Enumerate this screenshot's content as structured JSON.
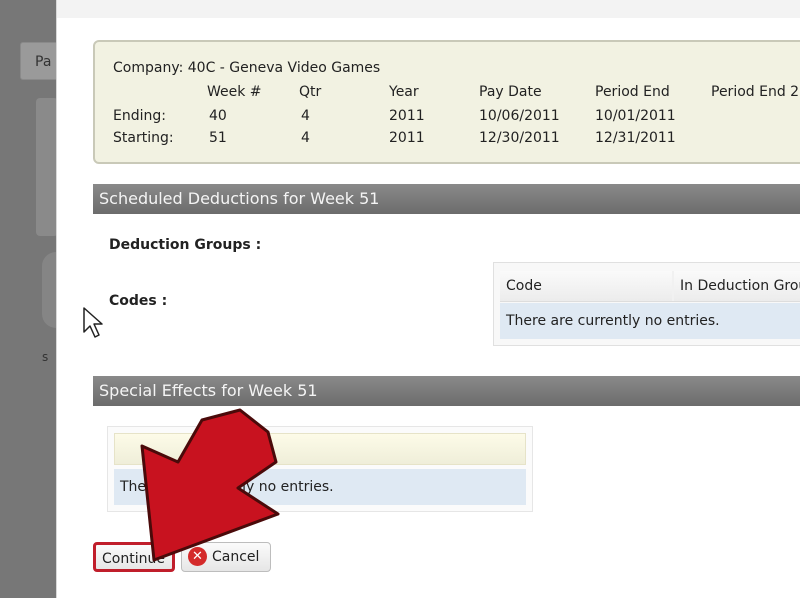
{
  "background": {
    "tab_label": "Pa",
    "side_letter": "s"
  },
  "info": {
    "company": "Company: 40C - Geneva Video Games",
    "headers": [
      "Week #",
      "Qtr",
      "Year",
      "Pay Date",
      "Period End",
      "Period End 2"
    ],
    "ending": {
      "label": "Ending:",
      "values": [
        "40",
        "4",
        "2011",
        "10/06/2011",
        "10/01/2011"
      ]
    },
    "starting": {
      "label": "Starting:",
      "values": [
        "51",
        "4",
        "2011",
        "12/30/2011",
        "12/31/2011"
      ]
    }
  },
  "deductions": {
    "title": "Scheduled Deductions for Week 51",
    "groups_label": "Deduction Groups :",
    "codes_label": "Codes :",
    "grid": {
      "columns": [
        "Code",
        "In Deduction Group"
      ],
      "empty_message": "There are currently no entries."
    }
  },
  "special_effects": {
    "title": "Special Effects for Week 51",
    "empty_message": "There are currently no entries."
  },
  "buttons": {
    "continue": "Continue",
    "cancel": "Cancel"
  },
  "colors": {
    "section_bar": "#777777",
    "info_box": "#f2f2e2",
    "empty_row": "#dfe9f3",
    "highlight_red": "#c01e2b"
  },
  "overlay": {
    "arrow_icon": "large-red-arrow-icon",
    "cursor_icon": "mouse-pointer-icon"
  }
}
